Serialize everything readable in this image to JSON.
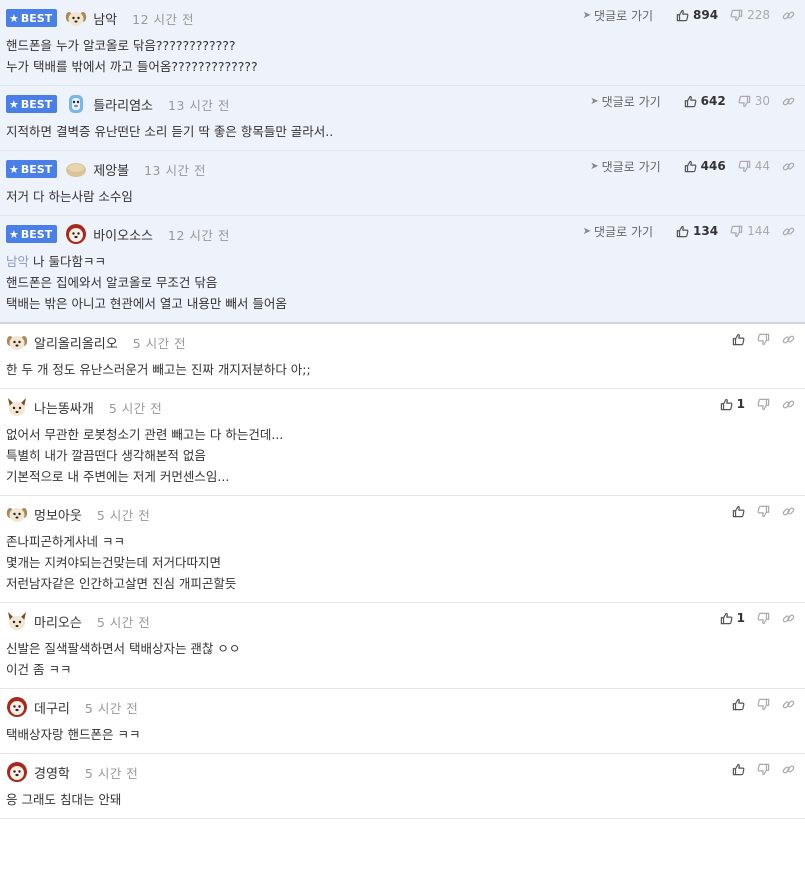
{
  "labels": {
    "best_badge": "BEST",
    "reply_link": "댓글로 가기"
  },
  "comments": [
    {
      "best": true,
      "nick": "남악",
      "time": "12 시간 전",
      "avatar": "dog-face",
      "up": "894",
      "down": "228",
      "lines": [
        "핸드폰을 누가 알코올로 닦음????????????",
        "누가 택배를 밖에서 까고 들어옴?????????????"
      ]
    },
    {
      "best": true,
      "nick": "틀라리염소",
      "time": "13 시간 전",
      "avatar": "blue-goat",
      "up": "642",
      "down": "30",
      "lines": [
        "지적하면 결벽증 유난떤단 소리 듣기 딱 좋은 항목들만 골라서.."
      ]
    },
    {
      "best": true,
      "nick": "제앙볼",
      "time": "13 시간 전",
      "avatar": "bread-blob",
      "up": "446",
      "down": "44",
      "lines": [
        "저거 다 하는사람 소수임"
      ]
    },
    {
      "best": true,
      "nick": "바이오소스",
      "time": "12 시간 전",
      "avatar": "red-dog",
      "up": "134",
      "down": "144",
      "mention": "남악",
      "lines": [
        "나 둘다함ㅋㅋ",
        "핸드폰은 집에와서 알코올로 무조건 닦음",
        "택배는 밖은 아니고 현관에서 열고 내용만 빼서 들어옴"
      ]
    },
    {
      "best": false,
      "nick": "알리올리올리오",
      "time": "5 시간 전",
      "avatar": "dog-face",
      "up": "",
      "lines": [
        "한 두 개 정도 유난스러운거 빼고는 진짜 개지저분하다 아;;"
      ]
    },
    {
      "best": false,
      "nick": "나는똥싸개",
      "time": "5 시간 전",
      "avatar": "fox-face",
      "up": "1",
      "lines": [
        "없어서 무관한 로봇청소기 관련 빼고는 다 하는건데...",
        "특별히 내가 깔끔떤다 생각해본적 없음",
        "기본적으로 내 주변에는 저게 커먼센스임..."
      ]
    },
    {
      "best": false,
      "nick": "멍보아웃",
      "time": "5 시간 전",
      "avatar": "dog-face",
      "up": "",
      "lines": [
        "존나피곤하게사네 ㅋㅋ",
        "몇개는 지켜야되는건맞는데 저거다따지면",
        "저런남자같은 인간하고살면 진심 개피곤할듯"
      ]
    },
    {
      "best": false,
      "nick": "마리오슨",
      "time": "5 시간 전",
      "avatar": "fox-face",
      "up": "1",
      "lines": [
        "신발은 질색팔색하면서 택배상자는 괜찮 ㅇㅇ",
        "이건 좀 ㅋㅋ"
      ]
    },
    {
      "best": false,
      "nick": "데구리",
      "time": "5 시간 전",
      "avatar": "red-dog",
      "up": "",
      "lines": [
        "택배상자랑 핸드폰은 ㅋㅋ"
      ]
    },
    {
      "best": false,
      "nick": "경영학",
      "time": "5 시간 전",
      "avatar": "red-dog",
      "up": "",
      "lines": [
        "응 그래도 침대는 안돼"
      ]
    }
  ]
}
